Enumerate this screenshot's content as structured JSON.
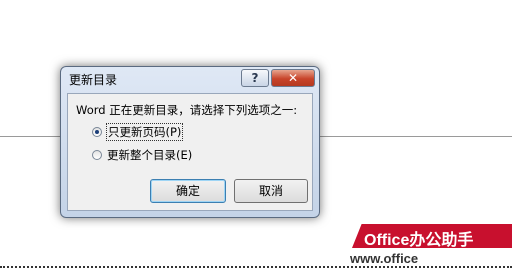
{
  "dialog": {
    "title": "更新目录",
    "help_label": "?",
    "close_label": "✕",
    "prompt": "Word 正在更新目录，请选择下列选项之一:",
    "options": [
      {
        "label": "只更新页码(P)",
        "checked": true
      },
      {
        "label": "更新整个目录(E)",
        "checked": false
      }
    ],
    "ok_label": "确定",
    "cancel_label": "取消"
  },
  "watermark": {
    "brand": "Office办公助手",
    "url": "www.office"
  }
}
